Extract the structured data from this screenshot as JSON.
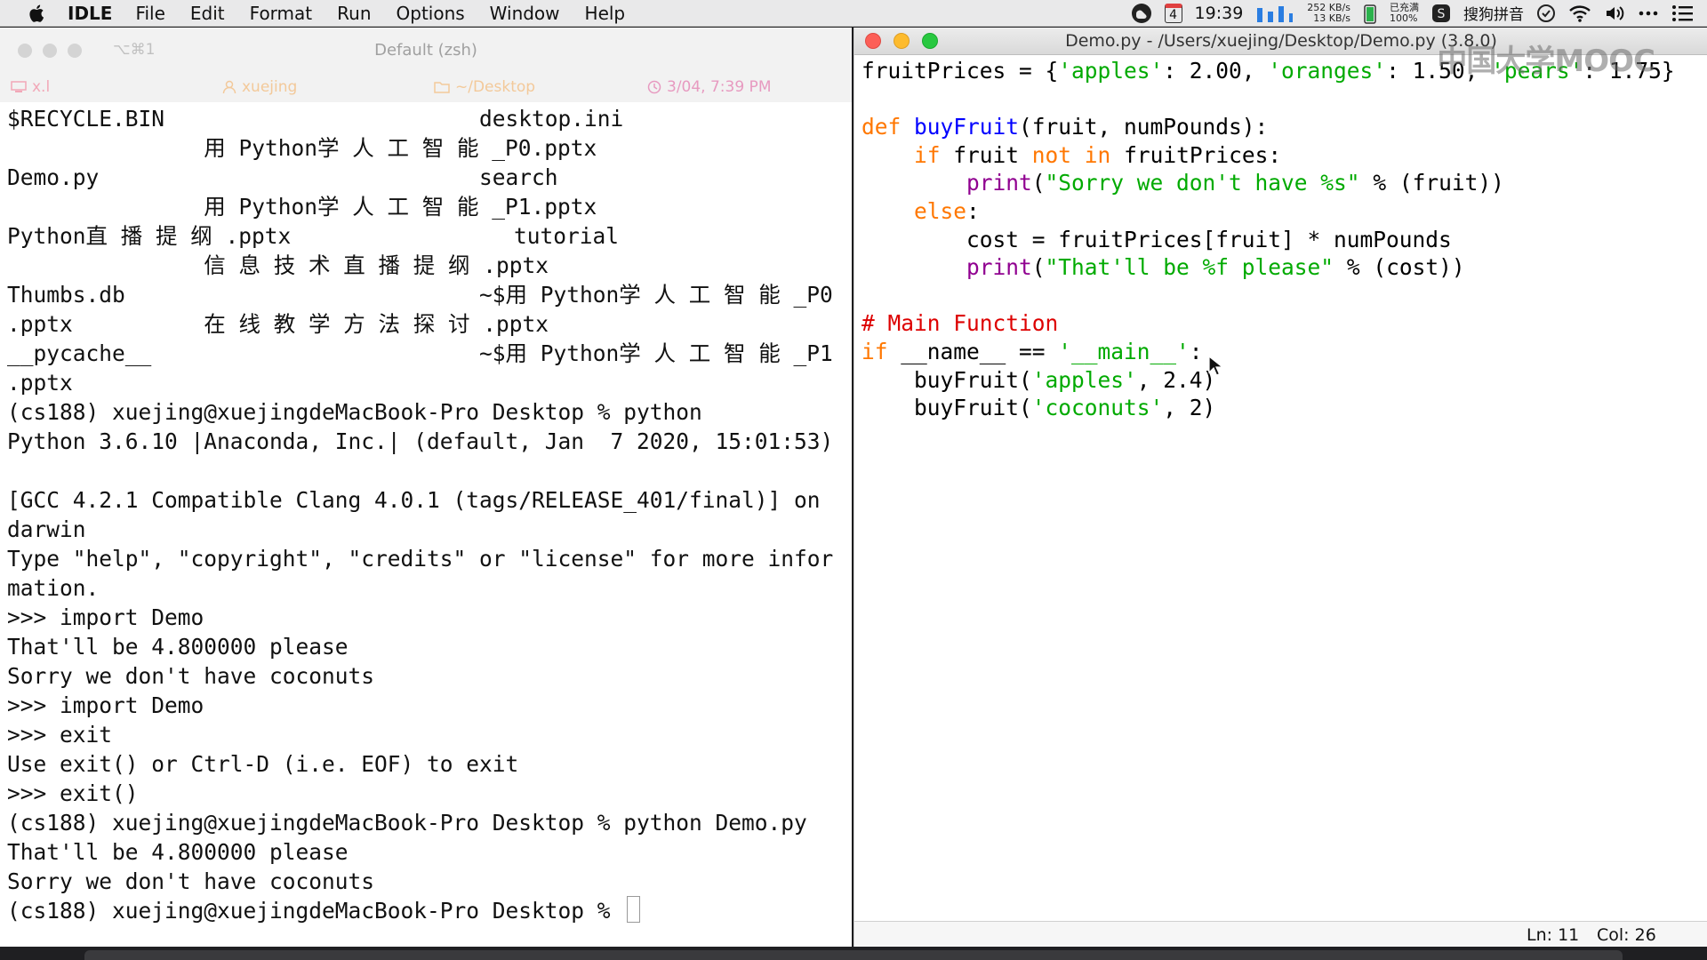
{
  "menubar": {
    "app_name": "IDLE",
    "menus": [
      "File",
      "Edit",
      "Format",
      "Run",
      "Options",
      "Window",
      "Help"
    ],
    "calendar_day": "4",
    "clock": "19:39",
    "net_up": "252 KB/s",
    "net_down": "13 KB/s",
    "battery": "已充满\n100%",
    "ime": "搜狗拼音"
  },
  "terminal": {
    "shortcut": "⌥⌘1",
    "title": "Default (zsh)",
    "status": {
      "tty": "x.l",
      "user": "xuejing",
      "dir": "~/Desktop",
      "datetime": "3/04, 7:39 PM"
    },
    "lines": [
      "$RECYCLE.BIN                        desktop.ini",
      "               用 Python学 人 工 智 能 _P0.pptx",
      "Demo.py                             search",
      "               用 Python学 人 工 智 能 _P1.pptx",
      "Python直 播 提 纲 .pptx                 tutorial",
      "               信 息 技 术 直 播 提 纲 .pptx",
      "Thumbs.db                           ~$用 Python学 人 工 智 能 _P0",
      ".pptx          在 线 教 学 方 法 探 讨 .pptx",
      "__pycache__                         ~$用 Python学 人 工 智 能 _P1",
      ".pptx",
      "(cs188) xuejing@xuejingdeMacBook-Pro Desktop % python",
      "Python 3.6.10 |Anaconda, Inc.| (default, Jan  7 2020, 15:01:53)",
      "",
      "[GCC 4.2.1 Compatible Clang 4.0.1 (tags/RELEASE_401/final)] on",
      "darwin",
      "Type \"help\", \"copyright\", \"credits\" or \"license\" for more infor",
      "mation.",
      ">>> import Demo",
      "That'll be 4.800000 please",
      "Sorry we don't have coconuts",
      ">>> import Demo",
      ">>> exit",
      "Use exit() or Ctrl-D (i.e. EOF) to exit",
      ">>> exit()",
      "(cs188) xuejing@xuejingdeMacBook-Pro Desktop % python Demo.py",
      "That'll be 4.800000 please",
      "Sorry we don't have coconuts"
    ],
    "prompt": "(cs188) xuejing@xuejingdeMacBook-Pro Desktop % "
  },
  "editor": {
    "title": "Demo.py - /Users/xuejing/Desktop/Demo.py (3.8.0)",
    "watermark": "中国大学MOOC",
    "code_lines": [
      [
        [
          "",
          "fruitPrices = {"
        ],
        [
          "st",
          "'apples'"
        ],
        [
          "",
          ": 2.00, "
        ],
        [
          "st",
          "'oranges'"
        ],
        [
          "",
          ": 1.50, "
        ],
        [
          "st",
          "'pears'"
        ],
        [
          "",
          ": 1.75}"
        ]
      ],
      [],
      [
        [
          "kw",
          "def "
        ],
        [
          "fn",
          "buyFruit"
        ],
        [
          "",
          "(fruit, numPounds):"
        ]
      ],
      [
        [
          "",
          "    "
        ],
        [
          "kw",
          "if"
        ],
        [
          "",
          " fruit "
        ],
        [
          "kw",
          "not in"
        ],
        [
          "",
          " fruitPrices:"
        ]
      ],
      [
        [
          "",
          "        "
        ],
        [
          "bi",
          "print"
        ],
        [
          "",
          "("
        ],
        [
          "st",
          "\"Sorry we don't have %s\""
        ],
        [
          "",
          " % (fruit))"
        ]
      ],
      [
        [
          "",
          "    "
        ],
        [
          "kw",
          "else"
        ],
        [
          "",
          ":"
        ]
      ],
      [
        [
          "",
          "        cost = fruitPrices[fruit] * numPounds"
        ]
      ],
      [
        [
          "",
          "        "
        ],
        [
          "bi",
          "print"
        ],
        [
          "",
          "("
        ],
        [
          "st",
          "\"That'll be %f please\""
        ],
        [
          "",
          " % (cost))"
        ]
      ],
      [],
      [
        [
          "cm",
          "# Main Function"
        ]
      ],
      [
        [
          "kw",
          "if"
        ],
        [
          "",
          " __name__ == "
        ],
        [
          "st",
          "'__main__'"
        ],
        [
          "",
          ":"
        ]
      ],
      [
        [
          "",
          "    buyFruit("
        ],
        [
          "st",
          "'apples'"
        ],
        [
          "",
          ", 2.4)"
        ]
      ],
      [
        [
          "",
          "    buyFruit("
        ],
        [
          "st",
          "'coconuts'"
        ],
        [
          "",
          ", 2)"
        ]
      ]
    ],
    "status_ln": "Ln: 11",
    "status_col": "Col: 26"
  }
}
